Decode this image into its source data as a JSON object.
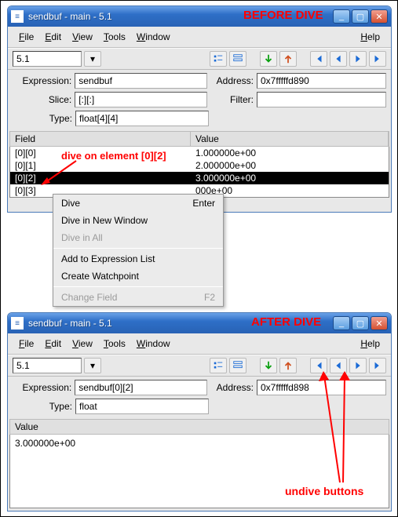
{
  "before": {
    "annot": "BEFORE DIVE",
    "title": "sendbuf - main - 5.1",
    "menus": {
      "file": "File",
      "edit": "Edit",
      "view": "View",
      "tools": "Tools",
      "window": "Window",
      "help": "Help"
    },
    "combo": "5.1",
    "fields": {
      "expression_label": "Expression:",
      "expression": "sendbuf",
      "address_label": "Address:",
      "address": "0x7fffffd890",
      "slice_label": "Slice:",
      "slice": "[:][:]",
      "filter_label": "Filter:",
      "filter": "",
      "type_label": "Type:",
      "type": "float[4][4]"
    },
    "columns": {
      "field": "Field",
      "value": "Value"
    },
    "rows": [
      {
        "field": "[0][0]",
        "value": "1.000000e+00"
      },
      {
        "field": "[0][1]",
        "value": "2.000000e+00"
      },
      {
        "field": "[0][2]",
        "value": "3.000000e+00",
        "selected": true
      },
      {
        "field": "[0][3]",
        "value": "000e+00"
      }
    ],
    "dive_annot": "dive on element [0][2]",
    "context_menu": {
      "dive": "Dive",
      "dive_shortcut": "Enter",
      "dive_new": "Dive in New Window",
      "dive_all": "Dive in All",
      "add_expr": "Add to Expression List",
      "create_wp": "Create Watchpoint",
      "change_field": "Change Field",
      "change_field_shortcut": "F2"
    }
  },
  "after": {
    "annot": "AFTER DIVE",
    "title": "sendbuf - main - 5.1",
    "menus": {
      "file": "File",
      "edit": "Edit",
      "view": "View",
      "tools": "Tools",
      "window": "Window",
      "help": "Help"
    },
    "combo": "5.1",
    "fields": {
      "expression_label": "Expression:",
      "expression": "sendbuf[0][2]",
      "address_label": "Address:",
      "address": "0x7fffffd898",
      "type_label": "Type:",
      "type": "float"
    },
    "value_label": "Value",
    "value": "3.000000e+00",
    "undive_annot": "undive buttons"
  }
}
